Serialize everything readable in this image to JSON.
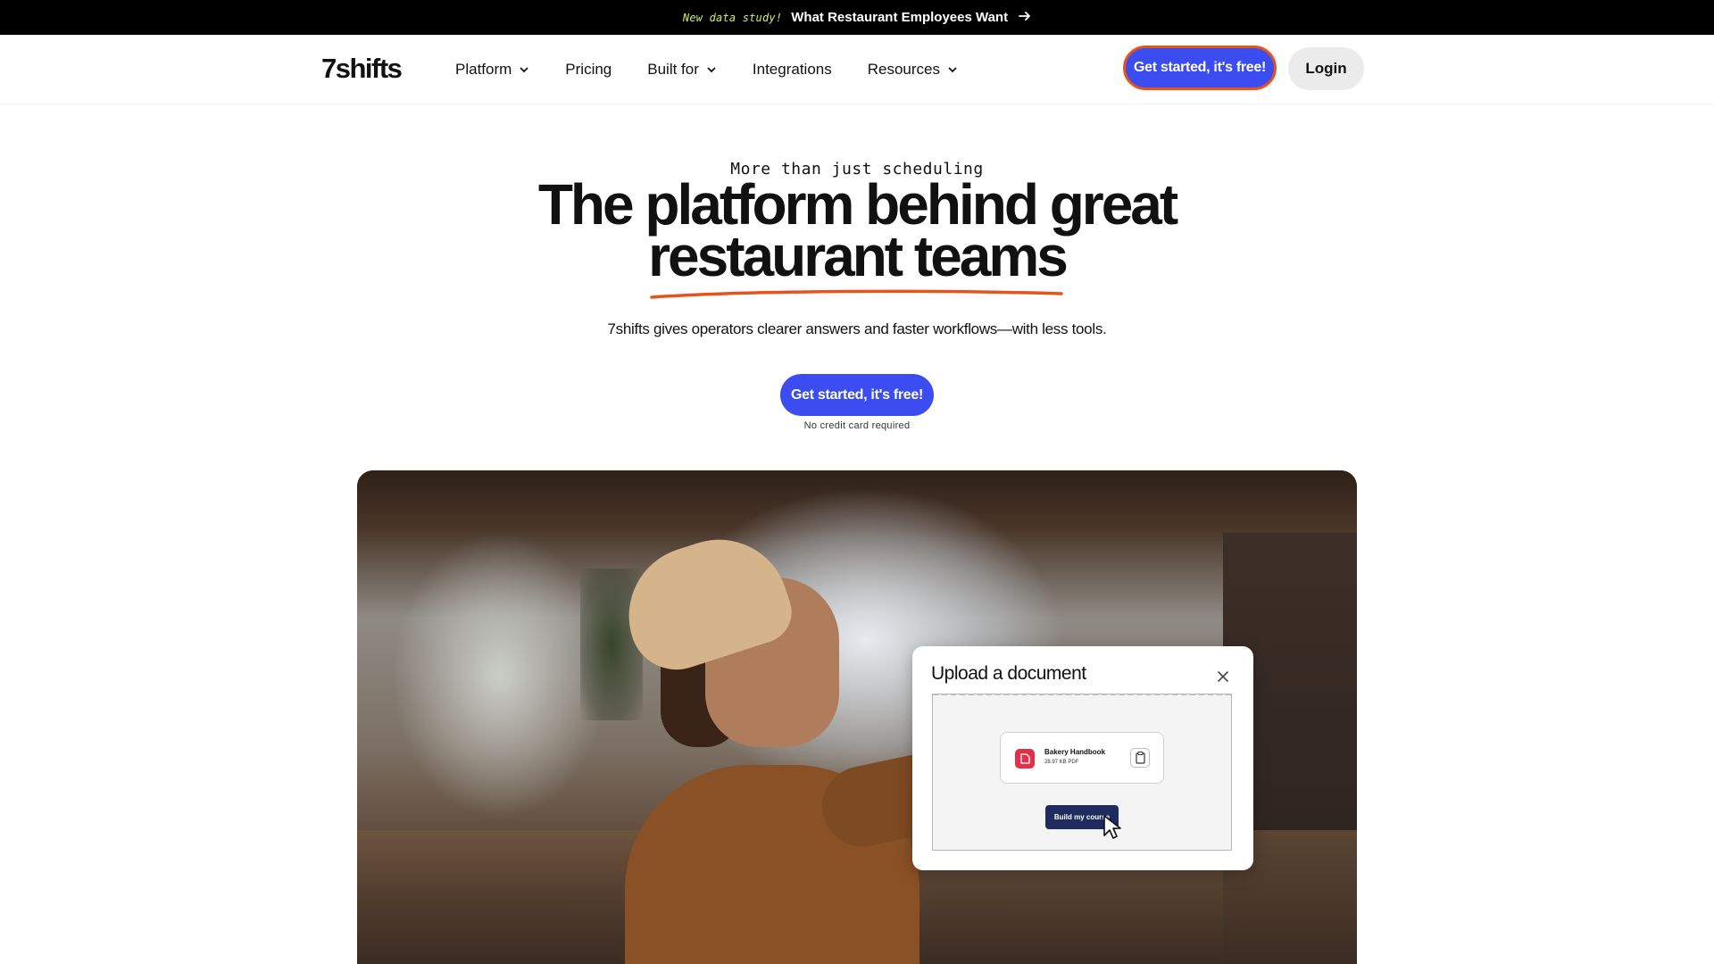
{
  "announcement": {
    "tag": "New data study!",
    "text": "What Restaurant Employees Want",
    "arrow_icon": "arrow-right-icon"
  },
  "nav": {
    "logo": "7shifts",
    "items": [
      {
        "label": "Platform",
        "has_dropdown": true
      },
      {
        "label": "Pricing",
        "has_dropdown": false
      },
      {
        "label": "Built for",
        "has_dropdown": true
      },
      {
        "label": "Integrations",
        "has_dropdown": false
      },
      {
        "label": "Resources",
        "has_dropdown": true
      }
    ],
    "cta_label": "Get started, it's free!",
    "login_label": "Login"
  },
  "hero": {
    "eyebrow": "More than just scheduling",
    "headline_line1": "The platform behind great",
    "headline_line2": "restaurant teams",
    "subhead": "7shifts gives operators clearer answers and faster workflows—with less tools.",
    "cta_label": "Get started, it's free!",
    "note": "No credit card required"
  },
  "upload_card": {
    "title": "Upload a document",
    "file_name": "Bakery Handbook",
    "file_meta": "28.97 KB PDF",
    "button_label": "Build my course"
  },
  "colors": {
    "brand_blue": "#3b4cf0",
    "accent_orange": "#e8531c",
    "announcement_bg": "#000000",
    "tag_green": "#c9f06a",
    "pdf_red": "#e0304a",
    "build_button_navy": "#1f2b5e"
  }
}
